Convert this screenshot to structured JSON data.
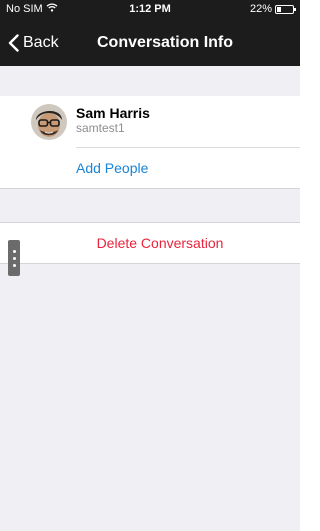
{
  "status_bar": {
    "carrier": "No SIM",
    "time": "1:12 PM",
    "battery_percent": "22%",
    "battery_level": 0.22,
    "wifi_icon": "wifi-icon",
    "battery_icon": "battery-icon"
  },
  "nav": {
    "back_label": "Back",
    "back_icon": "chevron-left-icon",
    "title": "Conversation Info"
  },
  "members": [
    {
      "name": "Sam Harris",
      "username": "samtest1",
      "avatar_icon": "user-avatar"
    }
  ],
  "actions": {
    "add_people_label": "Add People",
    "delete_label": "Delete Conversation"
  },
  "colors": {
    "nav_background": "#1c1c1c",
    "link_blue": "#1a84d6",
    "destructive_red": "#e8243c",
    "background_gray": "#efeff4"
  }
}
